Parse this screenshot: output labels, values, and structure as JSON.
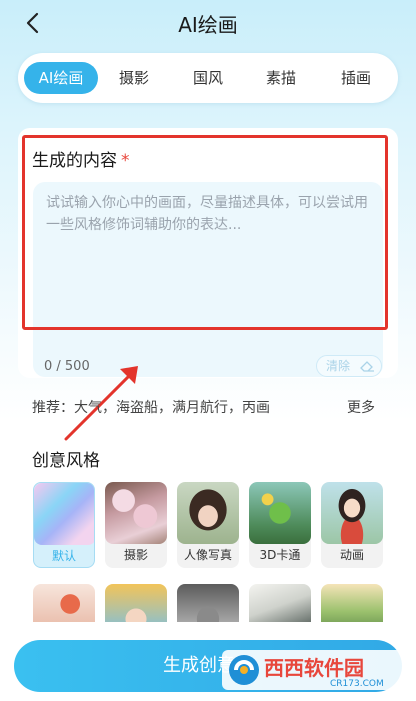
{
  "header": {
    "title": "AI绘画"
  },
  "tabs": [
    {
      "label": "AI绘画",
      "active": true
    },
    {
      "label": "摄影"
    },
    {
      "label": "国风"
    },
    {
      "label": "素描"
    },
    {
      "label": "插画"
    }
  ],
  "input_card": {
    "title": "生成的内容",
    "required_mark": "*",
    "placeholder": "试试输入你心中的画面，尽量描述具体，可以尝试用一些风格修饰词辅助你的表达...",
    "counter": "0 / 500",
    "clear_label": "清除"
  },
  "recommend": {
    "text": "推荐：大气，海盗船，满月航行，丙画",
    "more_label": "更多"
  },
  "styles": {
    "title": "创意风格",
    "items": [
      {
        "label": "默认",
        "selected": true
      },
      {
        "label": "摄影"
      },
      {
        "label": "人像写真"
      },
      {
        "label": "3D卡通"
      },
      {
        "label": "动画"
      }
    ]
  },
  "generate_button": {
    "label": "生成创意画"
  },
  "watermark": {
    "text": "西西软件园",
    "subtext": "CR173.COM"
  },
  "colors": {
    "accent": "#35b3ea",
    "annotation_red": "#e3342c"
  }
}
